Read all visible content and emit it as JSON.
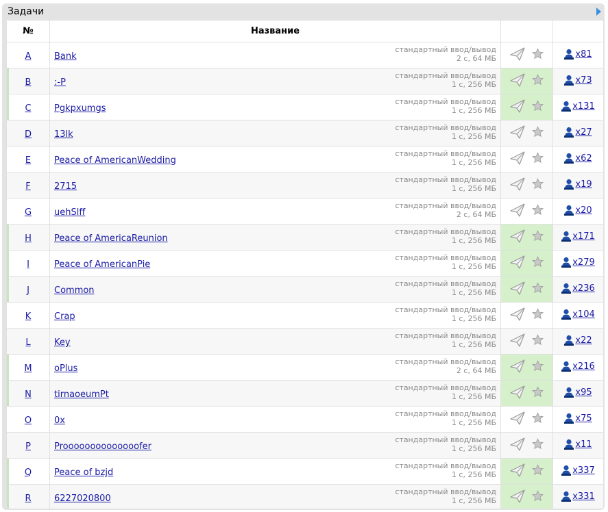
{
  "panel": {
    "title": "Задачи"
  },
  "table": {
    "headers": {
      "num": "№",
      "name": "Название"
    },
    "rows": [
      {
        "id": "A",
        "name": "Bank",
        "io": "стандартный ввод/вывод",
        "limits": "2 с, 64 МБ",
        "solved": false,
        "users": "x81"
      },
      {
        "id": "B",
        "name": ":-P",
        "io": "стандартный ввод/вывод",
        "limits": "1 с, 256 МБ",
        "solved": true,
        "users": "x73"
      },
      {
        "id": "C",
        "name": "Pgkpxumgs",
        "io": "стандартный ввод/вывод",
        "limits": "1 с, 256 МБ",
        "solved": true,
        "users": "x131"
      },
      {
        "id": "D",
        "name": "13lk",
        "io": "стандартный ввод/вывод",
        "limits": "1 с, 256 МБ",
        "solved": false,
        "users": "x27"
      },
      {
        "id": "E",
        "name": "Peace of AmericanWedding",
        "io": "стандартный ввод/вывод",
        "limits": "1 с, 256 МБ",
        "solved": false,
        "users": "x62"
      },
      {
        "id": "F",
        "name": "2715",
        "io": "стандартный ввод/вывод",
        "limits": "1 с, 256 МБ",
        "solved": false,
        "users": "x19"
      },
      {
        "id": "G",
        "name": "uehSlff",
        "io": "стандартный ввод/вывод",
        "limits": "2 с, 64 МБ",
        "solved": false,
        "users": "x20"
      },
      {
        "id": "H",
        "name": "Peace of AmericaReunion",
        "io": "стандартный ввод/вывод",
        "limits": "1 с, 256 МБ",
        "solved": true,
        "users": "x171"
      },
      {
        "id": "I",
        "name": "Peace of AmericanPie",
        "io": "стандартный ввод/вывод",
        "limits": "1 с, 256 МБ",
        "solved": true,
        "users": "x279"
      },
      {
        "id": "J",
        "name": "Common",
        "io": "стандартный ввод/вывод",
        "limits": "1 с, 256 МБ",
        "solved": true,
        "users": "x236"
      },
      {
        "id": "K",
        "name": "Crap",
        "io": "стандартный ввод/вывод",
        "limits": "1 с, 256 МБ",
        "solved": false,
        "users": "x104"
      },
      {
        "id": "L",
        "name": "Key",
        "io": "стандартный ввод/вывод",
        "limits": "1 с, 256 МБ",
        "solved": false,
        "users": "x22"
      },
      {
        "id": "M",
        "name": "oPlus",
        "io": "стандартный ввод/вывод",
        "limits": "2 с, 64 МБ",
        "solved": true,
        "users": "x216"
      },
      {
        "id": "N",
        "name": "tirnaoeumPt",
        "io": "стандартный ввод/вывод",
        "limits": "1 с, 256 МБ",
        "solved": true,
        "users": "x95"
      },
      {
        "id": "O",
        "name": "0x",
        "io": "стандартный ввод/вывод",
        "limits": "1 с, 256 МБ",
        "solved": false,
        "users": "x75"
      },
      {
        "id": "P",
        "name": "Proooooooooooooofer",
        "io": "стандартный ввод/вывод",
        "limits": "1 с, 256 МБ",
        "solved": false,
        "users": "x11"
      },
      {
        "id": "Q",
        "name": "Peace of bzjd",
        "io": "стандартный ввод/вывод",
        "limits": "1 с, 256 МБ",
        "solved": true,
        "users": "x337"
      },
      {
        "id": "R",
        "name": "6227020800",
        "io": "стандартный ввод/вывод",
        "limits": "1 с, 256 МБ",
        "solved": true,
        "users": "x331"
      }
    ]
  },
  "icons": {
    "expand": "triangle-right-icon",
    "submit": "paper-plane-icon",
    "favorite": "star-icon",
    "solvers": "user-icon"
  },
  "colors": {
    "link": "#1a1aa6",
    "solved_bg": "#d5f0cb",
    "solved_stripe": "#c8e6bb",
    "user_icon": "#1f4fa8",
    "expand_arrow": "#3b8fe0"
  }
}
